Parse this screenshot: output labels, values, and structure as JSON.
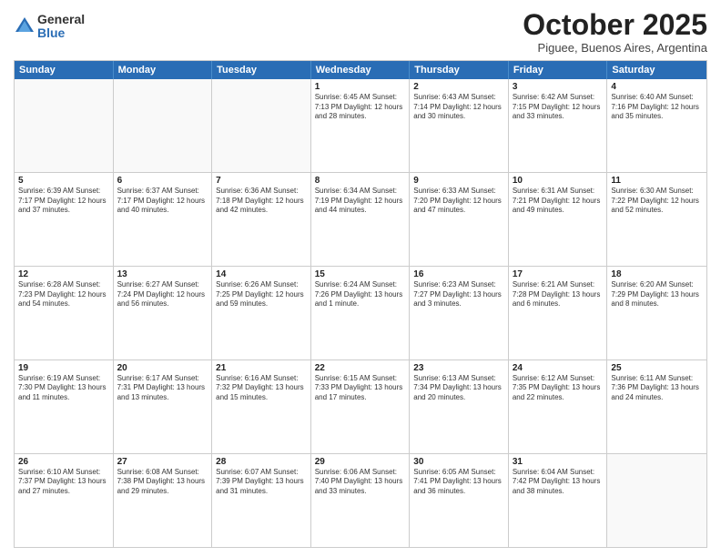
{
  "logo": {
    "general": "General",
    "blue": "Blue"
  },
  "title": "October 2025",
  "location": "Piguee, Buenos Aires, Argentina",
  "weekdays": [
    "Sunday",
    "Monday",
    "Tuesday",
    "Wednesday",
    "Thursday",
    "Friday",
    "Saturday"
  ],
  "weeks": [
    [
      {
        "day": "",
        "info": ""
      },
      {
        "day": "",
        "info": ""
      },
      {
        "day": "",
        "info": ""
      },
      {
        "day": "1",
        "info": "Sunrise: 6:45 AM\nSunset: 7:13 PM\nDaylight: 12 hours\nand 28 minutes."
      },
      {
        "day": "2",
        "info": "Sunrise: 6:43 AM\nSunset: 7:14 PM\nDaylight: 12 hours\nand 30 minutes."
      },
      {
        "day": "3",
        "info": "Sunrise: 6:42 AM\nSunset: 7:15 PM\nDaylight: 12 hours\nand 33 minutes."
      },
      {
        "day": "4",
        "info": "Sunrise: 6:40 AM\nSunset: 7:16 PM\nDaylight: 12 hours\nand 35 minutes."
      }
    ],
    [
      {
        "day": "5",
        "info": "Sunrise: 6:39 AM\nSunset: 7:17 PM\nDaylight: 12 hours\nand 37 minutes."
      },
      {
        "day": "6",
        "info": "Sunrise: 6:37 AM\nSunset: 7:17 PM\nDaylight: 12 hours\nand 40 minutes."
      },
      {
        "day": "7",
        "info": "Sunrise: 6:36 AM\nSunset: 7:18 PM\nDaylight: 12 hours\nand 42 minutes."
      },
      {
        "day": "8",
        "info": "Sunrise: 6:34 AM\nSunset: 7:19 PM\nDaylight: 12 hours\nand 44 minutes."
      },
      {
        "day": "9",
        "info": "Sunrise: 6:33 AM\nSunset: 7:20 PM\nDaylight: 12 hours\nand 47 minutes."
      },
      {
        "day": "10",
        "info": "Sunrise: 6:31 AM\nSunset: 7:21 PM\nDaylight: 12 hours\nand 49 minutes."
      },
      {
        "day": "11",
        "info": "Sunrise: 6:30 AM\nSunset: 7:22 PM\nDaylight: 12 hours\nand 52 minutes."
      }
    ],
    [
      {
        "day": "12",
        "info": "Sunrise: 6:28 AM\nSunset: 7:23 PM\nDaylight: 12 hours\nand 54 minutes."
      },
      {
        "day": "13",
        "info": "Sunrise: 6:27 AM\nSunset: 7:24 PM\nDaylight: 12 hours\nand 56 minutes."
      },
      {
        "day": "14",
        "info": "Sunrise: 6:26 AM\nSunset: 7:25 PM\nDaylight: 12 hours\nand 59 minutes."
      },
      {
        "day": "15",
        "info": "Sunrise: 6:24 AM\nSunset: 7:26 PM\nDaylight: 13 hours\nand 1 minute."
      },
      {
        "day": "16",
        "info": "Sunrise: 6:23 AM\nSunset: 7:27 PM\nDaylight: 13 hours\nand 3 minutes."
      },
      {
        "day": "17",
        "info": "Sunrise: 6:21 AM\nSunset: 7:28 PM\nDaylight: 13 hours\nand 6 minutes."
      },
      {
        "day": "18",
        "info": "Sunrise: 6:20 AM\nSunset: 7:29 PM\nDaylight: 13 hours\nand 8 minutes."
      }
    ],
    [
      {
        "day": "19",
        "info": "Sunrise: 6:19 AM\nSunset: 7:30 PM\nDaylight: 13 hours\nand 11 minutes."
      },
      {
        "day": "20",
        "info": "Sunrise: 6:17 AM\nSunset: 7:31 PM\nDaylight: 13 hours\nand 13 minutes."
      },
      {
        "day": "21",
        "info": "Sunrise: 6:16 AM\nSunset: 7:32 PM\nDaylight: 13 hours\nand 15 minutes."
      },
      {
        "day": "22",
        "info": "Sunrise: 6:15 AM\nSunset: 7:33 PM\nDaylight: 13 hours\nand 17 minutes."
      },
      {
        "day": "23",
        "info": "Sunrise: 6:13 AM\nSunset: 7:34 PM\nDaylight: 13 hours\nand 20 minutes."
      },
      {
        "day": "24",
        "info": "Sunrise: 6:12 AM\nSunset: 7:35 PM\nDaylight: 13 hours\nand 22 minutes."
      },
      {
        "day": "25",
        "info": "Sunrise: 6:11 AM\nSunset: 7:36 PM\nDaylight: 13 hours\nand 24 minutes."
      }
    ],
    [
      {
        "day": "26",
        "info": "Sunrise: 6:10 AM\nSunset: 7:37 PM\nDaylight: 13 hours\nand 27 minutes."
      },
      {
        "day": "27",
        "info": "Sunrise: 6:08 AM\nSunset: 7:38 PM\nDaylight: 13 hours\nand 29 minutes."
      },
      {
        "day": "28",
        "info": "Sunrise: 6:07 AM\nSunset: 7:39 PM\nDaylight: 13 hours\nand 31 minutes."
      },
      {
        "day": "29",
        "info": "Sunrise: 6:06 AM\nSunset: 7:40 PM\nDaylight: 13 hours\nand 33 minutes."
      },
      {
        "day": "30",
        "info": "Sunrise: 6:05 AM\nSunset: 7:41 PM\nDaylight: 13 hours\nand 36 minutes."
      },
      {
        "day": "31",
        "info": "Sunrise: 6:04 AM\nSunset: 7:42 PM\nDaylight: 13 hours\nand 38 minutes."
      },
      {
        "day": "",
        "info": ""
      }
    ]
  ]
}
